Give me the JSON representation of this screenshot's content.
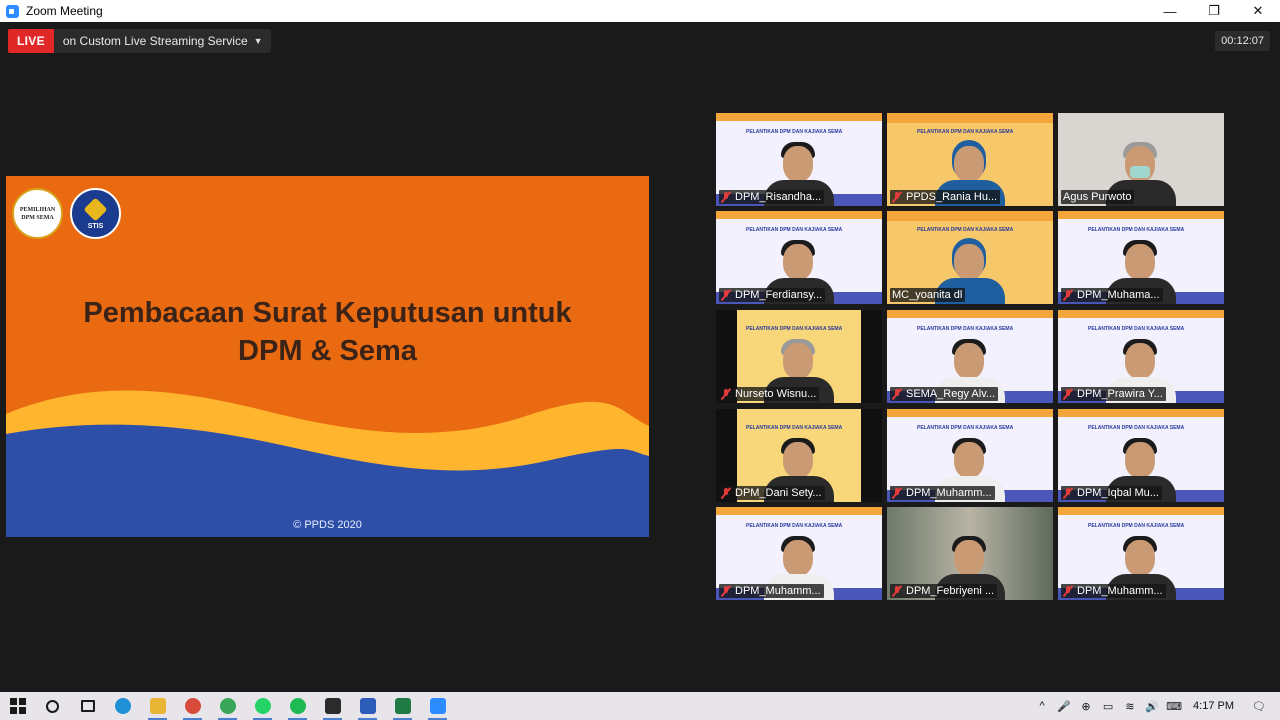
{
  "window": {
    "title": "Zoom Meeting",
    "controls": [
      "—",
      "❐",
      "✕"
    ]
  },
  "live": {
    "badge": "LIVE",
    "label": "on Custom Live Streaming Service",
    "caret": "▼"
  },
  "timer": "00:12:07",
  "slide": {
    "logos": {
      "left": [
        "PEMILIHAN",
        "DPM SEMA"
      ],
      "right": "STIS"
    },
    "title_line1": "Pembacaan Surat Keputusan untuk",
    "title_line2": "DPM & Sema",
    "footer": "© PPDS 2020"
  },
  "participants": [
    {
      "name": "DPM_Risandha...",
      "muted": true,
      "bg": "banner",
      "person": "plain"
    },
    {
      "name": "PPDS_Rania Hu...",
      "muted": true,
      "bg": "orange",
      "person": "hijab"
    },
    {
      "name": "Agus Purwoto",
      "muted": false,
      "bg": "room",
      "person": "grey mask"
    },
    {
      "name": "DPM_Ferdiansy...",
      "muted": true,
      "bg": "banner",
      "person": "plain"
    },
    {
      "name": "MC_yoanita dl",
      "muted": false,
      "bg": "orange",
      "person": "hijab",
      "speaking": true
    },
    {
      "name": "DPM_Muhama...",
      "muted": true,
      "bg": "banner",
      "person": "plain"
    },
    {
      "name": "Nurseto Wisnu...",
      "muted": true,
      "bg": "dark",
      "person": "grey"
    },
    {
      "name": "SEMA_Regy Alv...",
      "muted": true,
      "bg": "banner",
      "person": "white"
    },
    {
      "name": "DPM_Prawira Y...",
      "muted": true,
      "bg": "banner",
      "person": "white"
    },
    {
      "name": "DPM_Dani Sety...",
      "muted": true,
      "bg": "dark",
      "person": "plain"
    },
    {
      "name": "DPM_Muhamm...",
      "muted": true,
      "bg": "banner",
      "person": "white"
    },
    {
      "name": "DPM_Iqbal Mu...",
      "muted": true,
      "bg": "banner",
      "person": "plain"
    },
    {
      "name": "DPM_Muhamm...",
      "muted": true,
      "bg": "banner",
      "person": "white"
    },
    {
      "name": "DPM_Febriyeni ...",
      "muted": true,
      "bg": "forest",
      "person": "plain"
    },
    {
      "name": "DPM_Muhamm...",
      "muted": true,
      "bg": "banner",
      "person": "plain"
    }
  ],
  "banner_text": "PELANTIKAN DPM DAN KAJIAKA SEMA",
  "taskbar": {
    "apps": [
      {
        "icon": "windows-start-icon",
        "color": "#1a1a1a"
      },
      {
        "icon": "search-icon",
        "color": "#1a1a1a"
      },
      {
        "icon": "task-view-icon",
        "color": "#1a1a1a"
      },
      {
        "icon": "edge-icon",
        "color": "#1f8fd6"
      },
      {
        "icon": "file-explorer-icon",
        "color": "#e8b634"
      },
      {
        "icon": "chrome-icon",
        "color": "#d84a3a"
      },
      {
        "icon": "chrome-icon",
        "color": "#3aa65a"
      },
      {
        "icon": "whatsapp-icon",
        "color": "#25d366"
      },
      {
        "icon": "spotify-icon",
        "color": "#1db954"
      },
      {
        "icon": "sticky-notes-icon",
        "color": "#2b2b2b"
      },
      {
        "icon": "word-icon",
        "color": "#2b5cb8"
      },
      {
        "icon": "excel-icon",
        "color": "#1f7a44"
      },
      {
        "icon": "zoom-icon",
        "color": "#2d8cff"
      }
    ],
    "tray": [
      "^",
      "🎤",
      "⊕",
      "▭",
      "≋",
      "🔊",
      "⌨"
    ],
    "clock": "4:17 PM",
    "notification": "🗨"
  }
}
